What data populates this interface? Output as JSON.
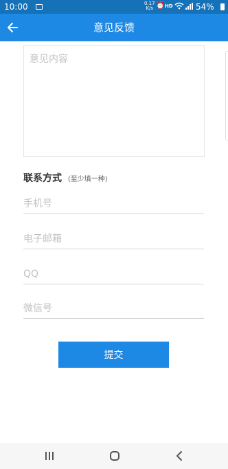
{
  "status_bar": {
    "time": "10:00",
    "net_speed": "0.17\nK/s",
    "hd": "HD",
    "battery": "54%"
  },
  "header": {
    "title": "意见反馈"
  },
  "feedback": {
    "placeholder": "意见内容"
  },
  "contact": {
    "heading": "联系方式",
    "hint": "(至少填一种)",
    "fields": [
      {
        "placeholder": "手机号"
      },
      {
        "placeholder": "电子邮箱"
      },
      {
        "placeholder": "QQ"
      },
      {
        "placeholder": "微信号"
      }
    ]
  },
  "submit_label": "提交",
  "colors": {
    "status_bar": "#1672b8",
    "header": "#1e88e5",
    "button": "#1e88e5",
    "placeholder": "#c2c2c2"
  }
}
